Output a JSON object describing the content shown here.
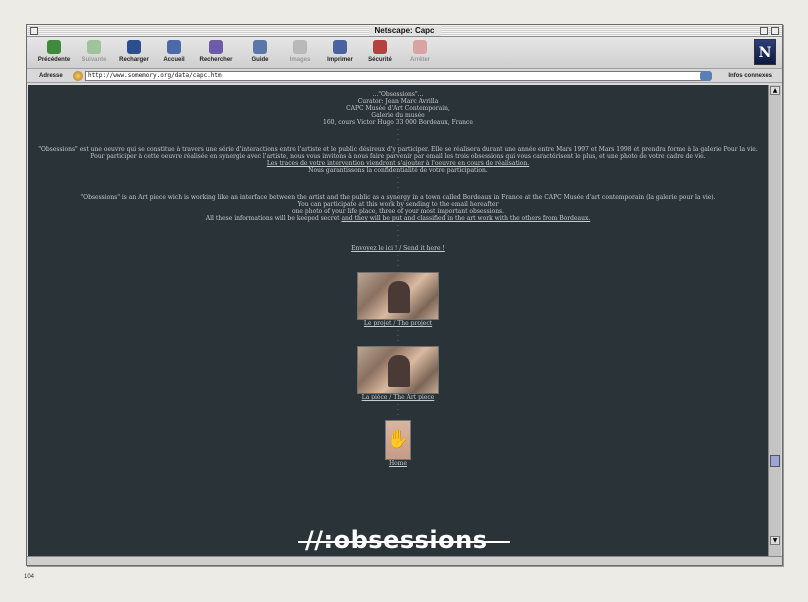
{
  "window": {
    "title": "Netscape: Capc"
  },
  "toolbar": {
    "buttons": [
      {
        "label": "Précédente",
        "disabled": false
      },
      {
        "label": "Suivante",
        "disabled": true
      },
      {
        "label": "Recharger",
        "disabled": false
      },
      {
        "label": "Accueil",
        "disabled": false
      },
      {
        "label": "Rechercher",
        "disabled": false
      },
      {
        "label": "Guide",
        "disabled": false
      },
      {
        "label": "Images",
        "disabled": true
      },
      {
        "label": "Imprimer",
        "disabled": false
      },
      {
        "label": "Sécurité",
        "disabled": false
      },
      {
        "label": "Arrêter",
        "disabled": true
      }
    ],
    "logo_letter": "N"
  },
  "location": {
    "label": "Adresse",
    "url": "http://www.somemory.org/data/capc.htm",
    "info_label": "Infos connexes"
  },
  "content": {
    "header_lines": [
      "...\"Obsessions\"...",
      "Curator: Jean Marc Avrilla",
      "CAPC Musée d'Art Contemporain,",
      "Galerie du musée",
      "160, cours Victor Hugo 33 000 Bordeaux, France"
    ],
    "fr_paragraph_1": "\"Obsessions\" est une oeuvre qui se constitue à travers une série d'interactions entre l'artiste et le public désireux d'y participer. Elle se réalisera durant une année entre Mars 1997 et Mars 1998 et prendra forme à la galerie Pour la vie.",
    "fr_paragraph_2": "Pour participer à cette oeuvre réalisée en synergie avec l'artiste, nous vous invitons à nous faire parvenir par email les trois obsessions qui vous caractérisent le plus, et une photo de votre cadre de vie.",
    "fr_paragraph_2_link": "Les traces de votre intervention viendront s'ajouter à l'oeuvre en cours de réalisation.",
    "fr_paragraph_3": "Nous garantissons la confidentialité de votre participation.",
    "en_lines": [
      "\"Obsessions\" is an Art piece wich is working like an interface between the artist and the public as a synergy in a town called Bordeaux in France at the CAPC Musée d'art contemporain (la galerie pour la vie).",
      "You can participate at this work by sending to the email hereafter",
      "one photo of your life place, three of your most important obsessions."
    ],
    "en_last_text": "All these informations will be keeped secret",
    "en_last_link": "and they will be put and classified in the art work with the others from Bordeaux.",
    "send_link": "Envoyez le ici ! / Send it here !",
    "project_link": "Le projet / The project",
    "art_piece_link": "La pièce / The Art piece",
    "home_link": "Home"
  },
  "overlay": {
    "title": "//:obsessions",
    "page_number": "104"
  }
}
